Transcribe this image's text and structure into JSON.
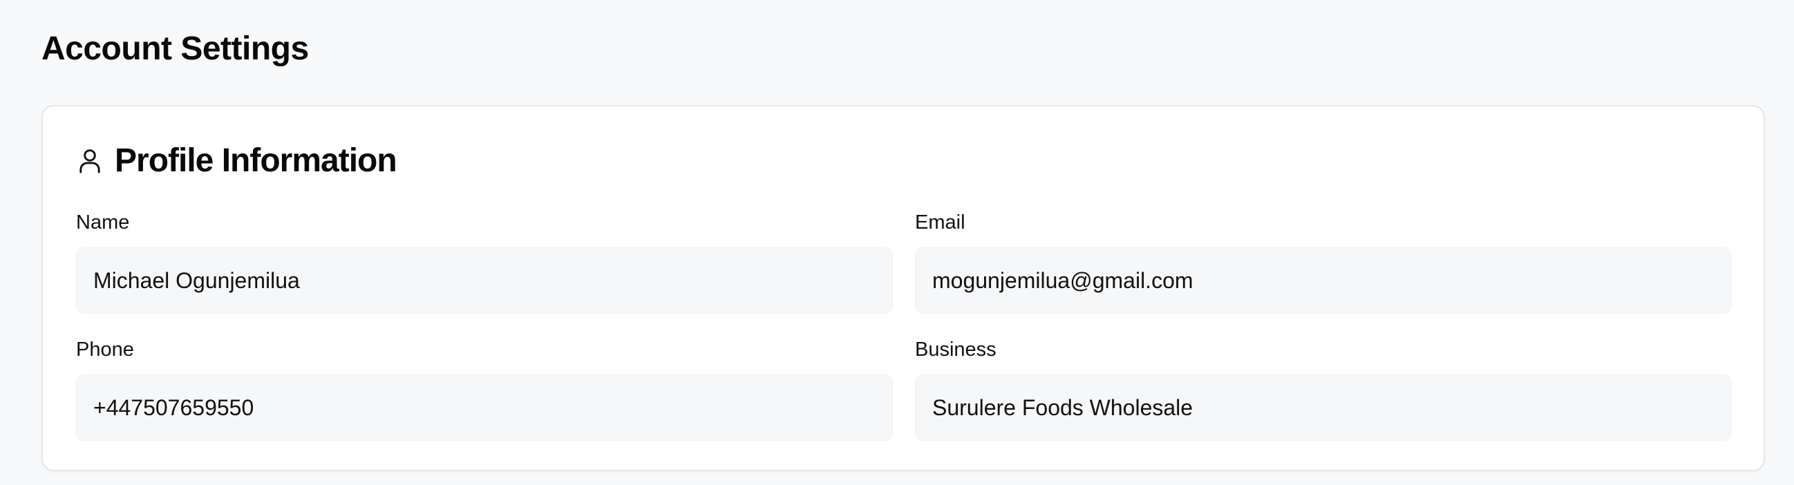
{
  "page": {
    "title": "Account Settings"
  },
  "profile_card": {
    "title": "Profile Information",
    "icon": "user-icon",
    "fields": {
      "name": {
        "label": "Name",
        "value": "Michael Ogunjemilua"
      },
      "email": {
        "label": "Email",
        "value": "mogunjemilua@gmail.com"
      },
      "phone": {
        "label": "Phone",
        "value": "+447507659550"
      },
      "business": {
        "label": "Business",
        "value": "Surulere Foods Wholesale"
      }
    }
  }
}
